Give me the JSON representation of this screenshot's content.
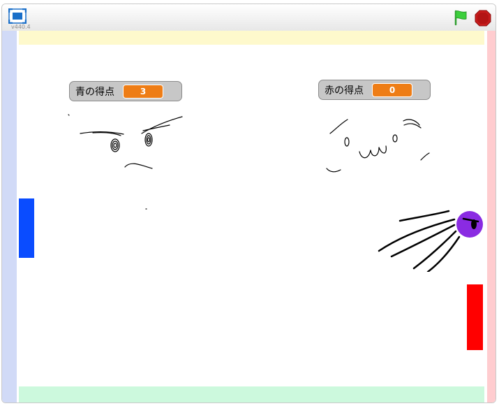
{
  "toolbar": {
    "version": "v440.4",
    "icons": {
      "fullscreen": "fullscreen-icon",
      "green_flag": "green-flag-icon",
      "stop": "stop-sign-icon"
    }
  },
  "stage": {
    "walls": {
      "left_color": "#d1daf7",
      "right_color": "#ffcccf",
      "top_color": "#fef9cc",
      "bottom_color": "#ccf9dd"
    },
    "monitors": {
      "blue": {
        "label": "青の得点",
        "value": "3"
      },
      "red": {
        "label": "赤の得点",
        "value": "0"
      }
    },
    "paddle_colors": {
      "blue": "#0a4cff",
      "red": "#ff0000"
    },
    "ball_color": "#8a2be2"
  }
}
